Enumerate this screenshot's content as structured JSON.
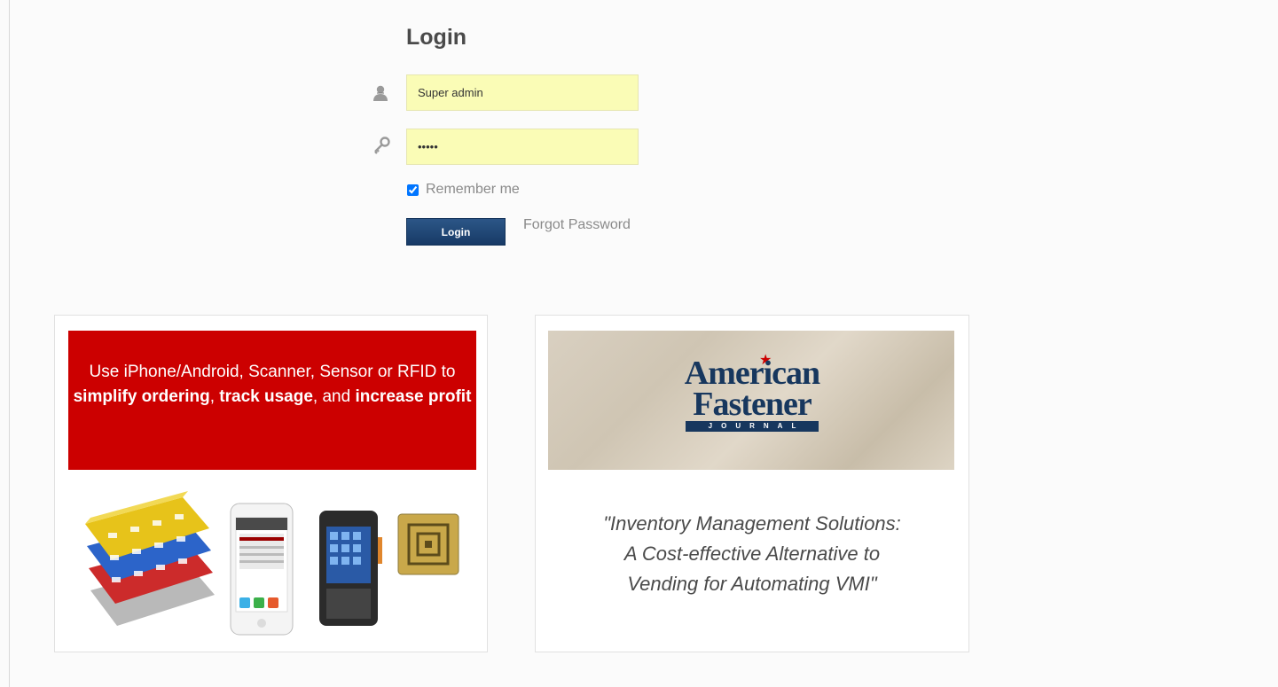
{
  "login": {
    "title": "Login",
    "username_value": "Super admin",
    "password_value": "admin",
    "remember_label": "Remember me",
    "remember_checked": true,
    "submit_label": "Login",
    "forgot_label": "Forgot Password"
  },
  "icons": {
    "username": "user-icon",
    "password": "key-icon"
  },
  "cards": {
    "promo": {
      "pre": "Use iPhone/Android, Scanner, Sensor or RFID to ",
      "b1": "simplify ordering",
      "sep1": ", ",
      "b2": "track usage",
      "sep2": ", and ",
      "b3": "increase profit"
    },
    "journal": {
      "line1": "American",
      "line2": "Fastener",
      "line3": "JOURNAL",
      "quote_l1": "\"Inventory Management Solutions:",
      "quote_l2": "A Cost-effective Alternative to",
      "quote_l3": "Vending for Automating VMI\""
    }
  },
  "colors": {
    "input_bg": "#fafcb6",
    "button": "#1f4a7b",
    "promo_red": "#cc0000",
    "journal_navy": "#17375e"
  }
}
